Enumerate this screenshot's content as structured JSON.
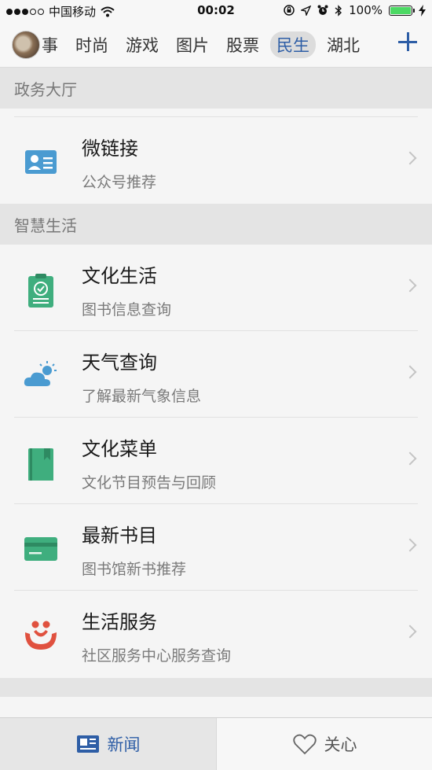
{
  "status_bar": {
    "carrier": "中国移动",
    "time": "00:02",
    "battery": "100%",
    "battery_level": 1.0
  },
  "nav": {
    "tabs": [
      {
        "label": "事",
        "active": false
      },
      {
        "label": "时尚",
        "active": false
      },
      {
        "label": "游戏",
        "active": false
      },
      {
        "label": "图片",
        "active": false
      },
      {
        "label": "股票",
        "active": false
      },
      {
        "label": "民生",
        "active": true
      },
      {
        "label": "湖北",
        "active": false
      }
    ]
  },
  "sections": [
    {
      "header": "政务大厅",
      "items": [
        {
          "title": "微链接",
          "subtitle": "公众号推荐",
          "icon": "contact-card-icon",
          "color": "#4a9bd1"
        }
      ]
    },
    {
      "header": "智慧生活",
      "items": [
        {
          "title": "文化生活",
          "subtitle": "图书信息查询",
          "icon": "clipboard-check-icon",
          "color": "#3fae7e"
        },
        {
          "title": "天气查询",
          "subtitle": "了解最新气象信息",
          "icon": "cloud-sun-icon",
          "color": "#4a9bd1"
        },
        {
          "title": "文化菜单",
          "subtitle": "文化节目预告与回顾",
          "icon": "bookmark-book-icon",
          "color": "#3fae7e"
        },
        {
          "title": "最新书目",
          "subtitle": "图书馆新书推荐",
          "icon": "card-icon",
          "color": "#3fae7e"
        },
        {
          "title": "生活服务",
          "subtitle": "社区服务中心服务查询",
          "icon": "community-logo-icon",
          "color": "#e0513f"
        }
      ]
    }
  ],
  "tabbar": {
    "news_label": "新闻",
    "care_label": "关心"
  },
  "colors": {
    "accent": "#2e5ea6",
    "battery": "#4cd964"
  }
}
